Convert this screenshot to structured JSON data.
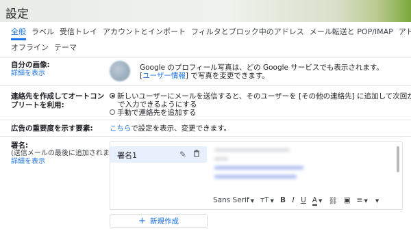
{
  "page": {
    "title": "設定"
  },
  "tabs": {
    "row1": [
      "全般",
      "ラベル",
      "受信トレイ",
      "アカウントとインポート",
      "フィルタとブロック中のアドレス",
      "メール転送と POP/IMAP",
      "アドオン"
    ],
    "row2": [
      "オフライン",
      "テーマ"
    ],
    "active": "全般"
  },
  "picture": {
    "label": "自分の画像:",
    "link": "詳細を表示",
    "line1": "Google のプロフィール写真は、どの Google サービスでも表示されます。",
    "line2_pre": "[",
    "line2_link": "ユーザー情報",
    "line2_post": "] で写真を変更できます。"
  },
  "autocomplete": {
    "label_l1": "連絡先を作成してオートコン",
    "label_l2": "プリートを利用:",
    "option1_l1": "新しいユーザーにメールを送信すると、そのユーザーを [その他の連絡先] に追加して次回か",
    "option1_l2": "で入力できるようにする",
    "option2": "手動で連絡先を追加する",
    "selected": "option1"
  },
  "ads": {
    "label": "広告の重要度を示す要素:",
    "link": "こちら",
    "text": "で設定を表示、変更できます。"
  },
  "signature": {
    "label": "署名:",
    "sub": "(送信メールの最後に追加されます)",
    "link": "詳細を表示",
    "item_name": "署名1",
    "toolbar": {
      "font": "Sans Serif"
    },
    "new_button": "新規作成",
    "new_icon": "plus-icon"
  },
  "colors": {
    "accent": "#1a73e8",
    "selected_bg": "#e8f0fe"
  }
}
